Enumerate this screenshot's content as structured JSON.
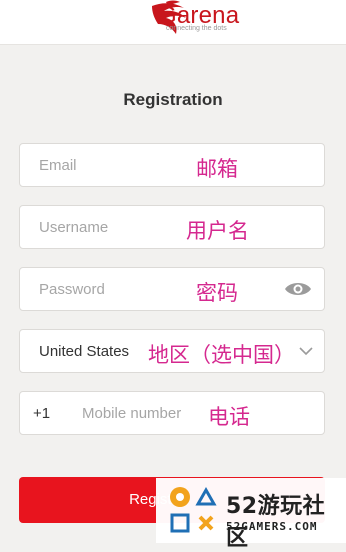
{
  "header": {
    "brand": "Garena",
    "tagline": "connecting the dots"
  },
  "form": {
    "title": "Registration",
    "email": {
      "placeholder": "Email",
      "annotation": "邮箱"
    },
    "username": {
      "placeholder": "Username",
      "annotation": "用户名"
    },
    "password": {
      "placeholder": "Password",
      "annotation": "密码"
    },
    "country": {
      "value": "United States",
      "annotation": "地区（选中国）"
    },
    "mobile": {
      "prefix": "+1",
      "placeholder": "Mobile number",
      "annotation": "电话"
    },
    "register_label": "Register"
  },
  "watermark": {
    "name": "52游玩社区",
    "site": "52GAMERS.COM"
  },
  "colors": {
    "brand_red": "#e8141e",
    "annotation_pink": "#d5288f"
  }
}
